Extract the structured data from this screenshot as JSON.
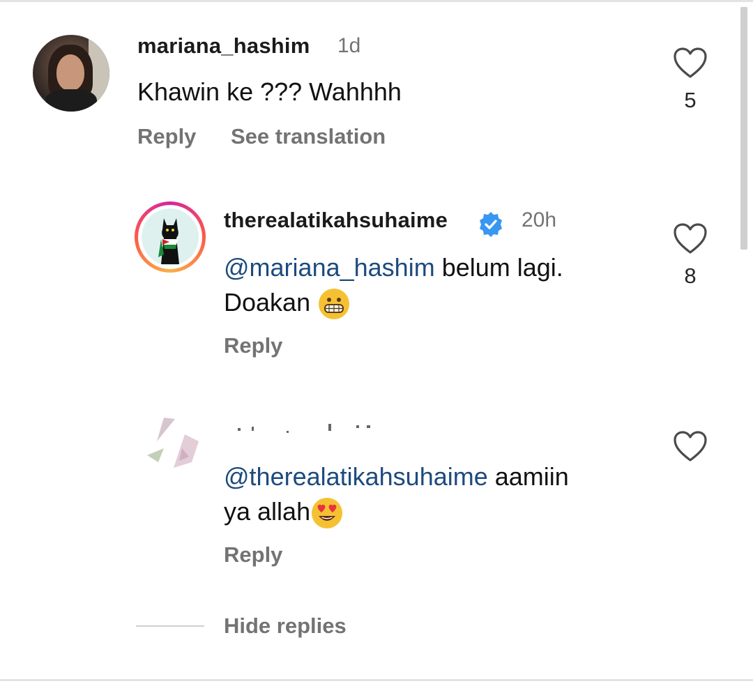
{
  "comments": [
    {
      "username": "mariana_hashim",
      "time": "1d",
      "text": "Khawin ke ??? Wahhhh",
      "likes": "5",
      "reply_label": "Reply",
      "translate_label": "See translation"
    }
  ],
  "replies": [
    {
      "username": "therealatikahsuhaime",
      "verified": true,
      "time": "20h",
      "mention": "@mariana_hashim",
      "text_line1": " belum lagi.",
      "text_line2": "Doakan",
      "emoji": "grinning-face-icon",
      "likes": "8",
      "reply_label": "Reply"
    },
    {
      "mention": "@therealatikahsuhaime",
      "text_line1": " aamiin",
      "text_line2": "ya allah",
      "emoji": "heart-eyes-icon",
      "reply_label": "Reply"
    }
  ],
  "hide_replies_label": "Hide replies",
  "colors": {
    "mention": "#1c4a7e",
    "muted": "#737373",
    "verified": "#3897f0"
  }
}
